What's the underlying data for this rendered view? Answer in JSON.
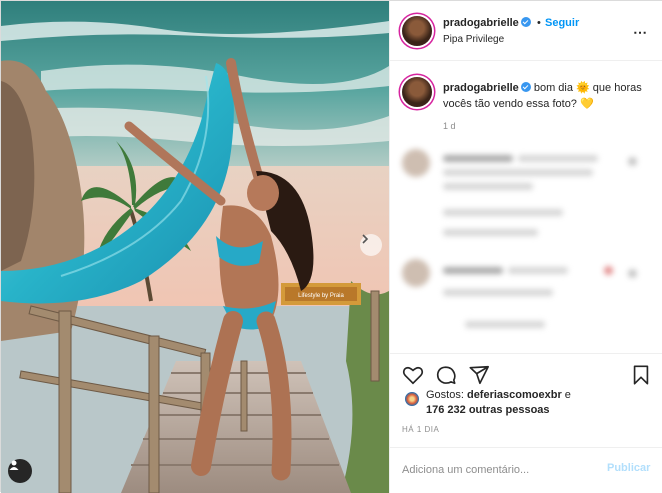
{
  "post": {
    "username": "pradogabrielle",
    "follow_dot": "•",
    "follow_label": "Seguir",
    "location": "Pipa Privilege",
    "more_icon": "⋯",
    "caption_user": "pradogabrielle",
    "caption_text": " bom dia 🌞 que horas vocês tão vendo essa foto? 💛",
    "caption_time": "1 d"
  },
  "photo": {
    "sign_text": "Lifestyle by Praia"
  },
  "likes": {
    "prefix": "Gostos: ",
    "user": "deferiascomoexbr",
    "joiner": " e",
    "count_text": "176 232 outras pessoas"
  },
  "timestamp": "HÁ 1 DIA",
  "comment": {
    "placeholder": "Adiciona um comentário...",
    "publish_label": "Publicar"
  },
  "colors": {
    "link_blue": "#0095f6",
    "verified_blue": "#3897f0",
    "publish_disabled": "#b2dffc",
    "muted": "#8e8e8e"
  },
  "icons": [
    "verified-icon",
    "more-options-icon",
    "heart-icon",
    "comment-icon",
    "share-icon",
    "bookmark-icon",
    "next-arrow-icon",
    "tag-person-icon"
  ]
}
